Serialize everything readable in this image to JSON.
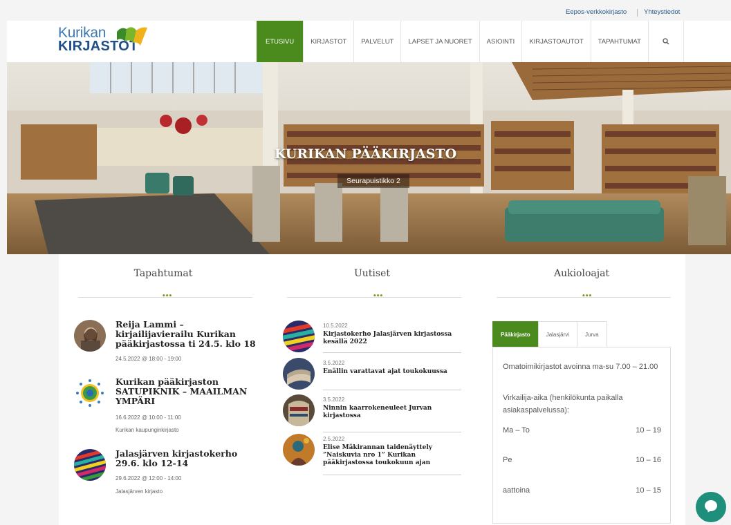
{
  "utility_links": {
    "eepos": "Eepos-verkkokirjasto",
    "contact": "Yhteystiedot"
  },
  "logo": {
    "top": "Kurikan",
    "bottom": "KIRJASTOT"
  },
  "nav": [
    "ETUSIVU",
    "KIRJASTOT",
    "PALVELUT",
    "LAPSET JA NUORET",
    "ASIOINTI",
    "KIRJASTOAUTOT",
    "TAPAHTUMAT"
  ],
  "nav_search_icon": "search-icon",
  "hero": {
    "title": "KURIKAN PÄÄKIRJASTO",
    "subtitle": "Seurapuistikko 2"
  },
  "events": {
    "heading": "Tapahtumat",
    "items": [
      {
        "title": "Reija Lammi – kirjailijavierailu Kurikan pääkirjastossa ti 24.5. klo 18",
        "time": "24.5.2022 @ 18:00 - 19:00",
        "place": ""
      },
      {
        "title": "Kurikan pääkirjaston SATUPIKNIK – MAAILMAN YMPÄRI",
        "time": "16.6.2022 @ 10:00 - 11:00",
        "place": "Kurikan kaupunginkirjasto"
      },
      {
        "title": "Jalasjärven kirjastokerho 29.6. klo 12-14",
        "time": "29.6.2022 @ 12:00 - 14:00",
        "place": "Jalasjärven kirjasto"
      }
    ]
  },
  "news": {
    "heading": "Uutiset",
    "items": [
      {
        "date": "10.5.2022",
        "title": "Kirjastokerho Jalasjärven kirjastossa kesällä 2022"
      },
      {
        "date": "3.5.2022",
        "title": "Enällin varattavat ajat toukokuussa"
      },
      {
        "date": "3.5.2022",
        "title": "Ninnin kaarrokeneuleet Jurvan kirjastossa"
      },
      {
        "date": "2.5.2022",
        "title": "Elise Mäkirannan taidenäyttely ”Naiskuvia nro 1” Kurikan pääkirjastossa toukokuun ajan"
      }
    ]
  },
  "hours": {
    "heading": "Aukioloajat",
    "tabs": [
      "Pääkirjasto",
      "Jalasjärvi",
      "Jurva"
    ],
    "self_service": "Omatoimikirjastot avoinna ma-su 7.00 – 21.00",
    "staffed_note": "Virkailija-aika (henkilökunta paikalla asiakaspalvelussa):",
    "rows": [
      {
        "day": "Ma – To",
        "time": "10 – 19"
      },
      {
        "day": "Pe",
        "time": "10 – 16"
      },
      {
        "day": "aattoina",
        "time": "10 – 15"
      }
    ]
  },
  "colors": {
    "brand_green": "#4b8a1d",
    "link_blue": "#2a5a8c",
    "chat": "#1d8f7a"
  }
}
